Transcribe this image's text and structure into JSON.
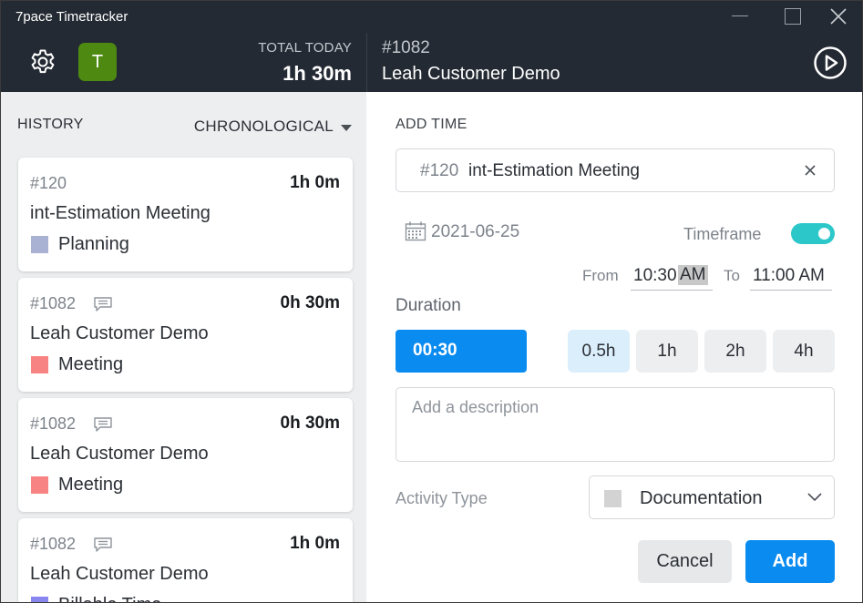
{
  "window": {
    "title": "7pace Timetracker"
  },
  "header": {
    "avatar_initial": "T",
    "total_today_label": "TOTAL TODAY",
    "total_today_value": "1h 30m",
    "current_item_id": "#1082",
    "current_item_name": "Leah Customer Demo"
  },
  "history": {
    "label": "HISTORY",
    "sort_label": "CHRONOLOGICAL",
    "entries": [
      {
        "id": "#120",
        "has_comment": false,
        "duration": "1h 0m",
        "name": "int-Estimation Meeting",
        "activity": "Planning",
        "activity_color": "#aab2d4"
      },
      {
        "id": "#1082",
        "has_comment": true,
        "duration": "0h 30m",
        "name": "Leah Customer Demo",
        "activity": "Meeting",
        "activity_color": "#f88383"
      },
      {
        "id": "#1082",
        "has_comment": true,
        "duration": "0h 30m",
        "name": "Leah Customer Demo",
        "activity": "Meeting",
        "activity_color": "#f88383"
      },
      {
        "id": "#1082",
        "has_comment": true,
        "duration": "1h 0m",
        "name": "Leah Customer Demo",
        "activity": "Billable Time",
        "activity_color": "#8a86ef"
      }
    ]
  },
  "add_time": {
    "label": "ADD TIME",
    "work_item_id": "#120",
    "work_item_name": "int-Estimation Meeting",
    "date": "2021-06-25",
    "timeframe_label": "Timeframe",
    "timeframe_enabled": true,
    "from_label": "From",
    "from_time": "10:30",
    "from_ampm": "AM",
    "to_label": "To",
    "to_value": "11:00 AM",
    "duration_label": "Duration",
    "duration_value": "00:30",
    "presets": [
      "0.5h",
      "1h",
      "2h",
      "4h"
    ],
    "active_preset": "0.5h",
    "description_placeholder": "Add a description",
    "activity_type_label": "Activity Type",
    "activity_type_value": "Documentation",
    "activity_type_color": "#d3d3d3",
    "cancel_label": "Cancel",
    "add_label": "Add"
  },
  "colors": {
    "header_bg": "#242a33",
    "accent_blue": "#0a8bf0",
    "toggle_teal": "#2cc7c9",
    "avatar_green": "#4e8a12"
  }
}
